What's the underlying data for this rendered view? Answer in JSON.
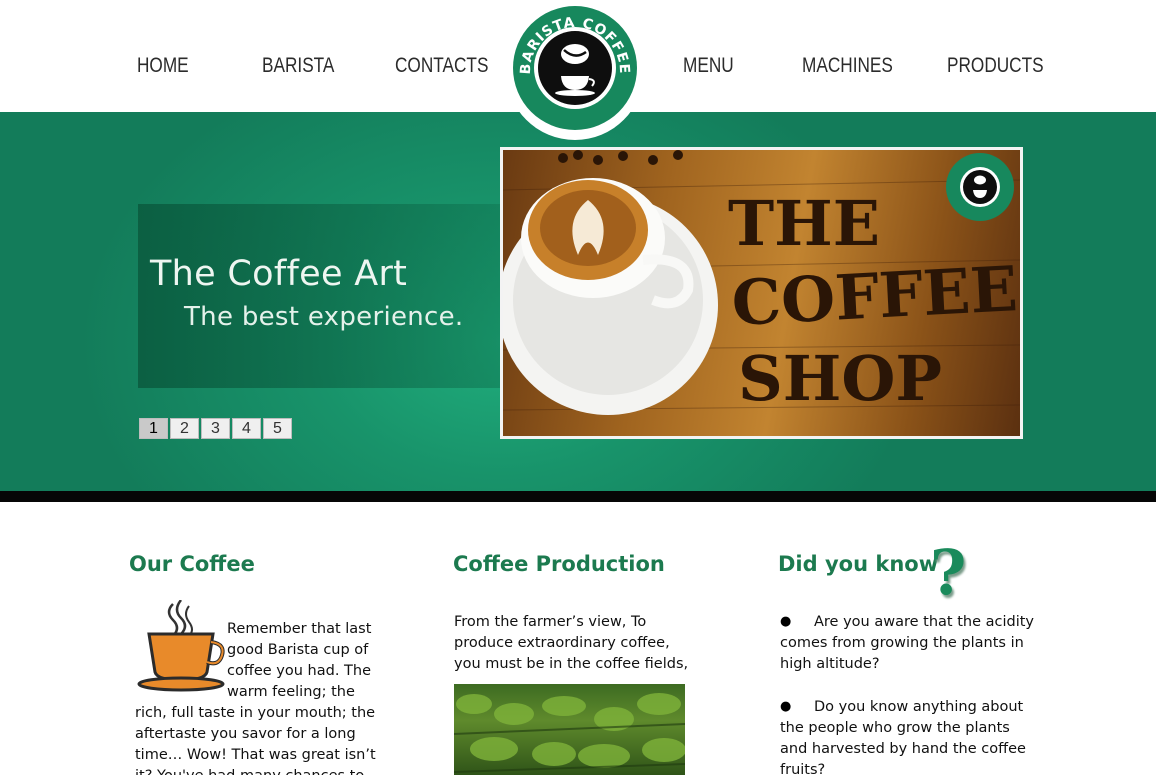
{
  "nav": {
    "items": [
      "HOME",
      "BARISTA",
      "CONTACTS",
      "MENU",
      "MACHINES",
      "PRODUCTS"
    ]
  },
  "logo": {
    "text": "BARISTA COFFEE"
  },
  "hero": {
    "title": "The Coffee Art",
    "subtitle": "The best experience.",
    "pager": [
      "1",
      "2",
      "3",
      "4",
      "5"
    ],
    "active_page": "1",
    "photo_alt": "THE COFFEE SHOP"
  },
  "columns": {
    "our_coffee": {
      "title": "Our Coffee",
      "lines": [
        "Remember that last",
        "good Barista cup of",
        "coffee you had. The",
        "warm feeling; the",
        "rich, full taste in your mouth; the",
        "aftertaste you savor for a long",
        "time… Wow! That was great isn’t",
        "it? You've had many chances to"
      ]
    },
    "production": {
      "title": "Coffee Production",
      "lines": [
        "From the farmer’s view, To",
        "produce extraordinary  coffee,",
        "you must  be in the coffee fields,"
      ]
    },
    "did_you_know": {
      "title": "Did you know",
      "qmark": "?",
      "bullet1": [
        "Are you aware that the acidity",
        "comes from growing the plants in",
        "high altitude?"
      ],
      "bullet2": [
        "Do you know anything about",
        "the people who grow the plants",
        "and harvested by hand the coffee",
        "fruits?"
      ]
    }
  },
  "colors": {
    "brand_green": "#1c7a4f",
    "hero_green": "#18936a"
  },
  "icons": [
    "coffee-cup-icon",
    "question-mark-icon",
    "coffee-bean-logo-icon"
  ]
}
